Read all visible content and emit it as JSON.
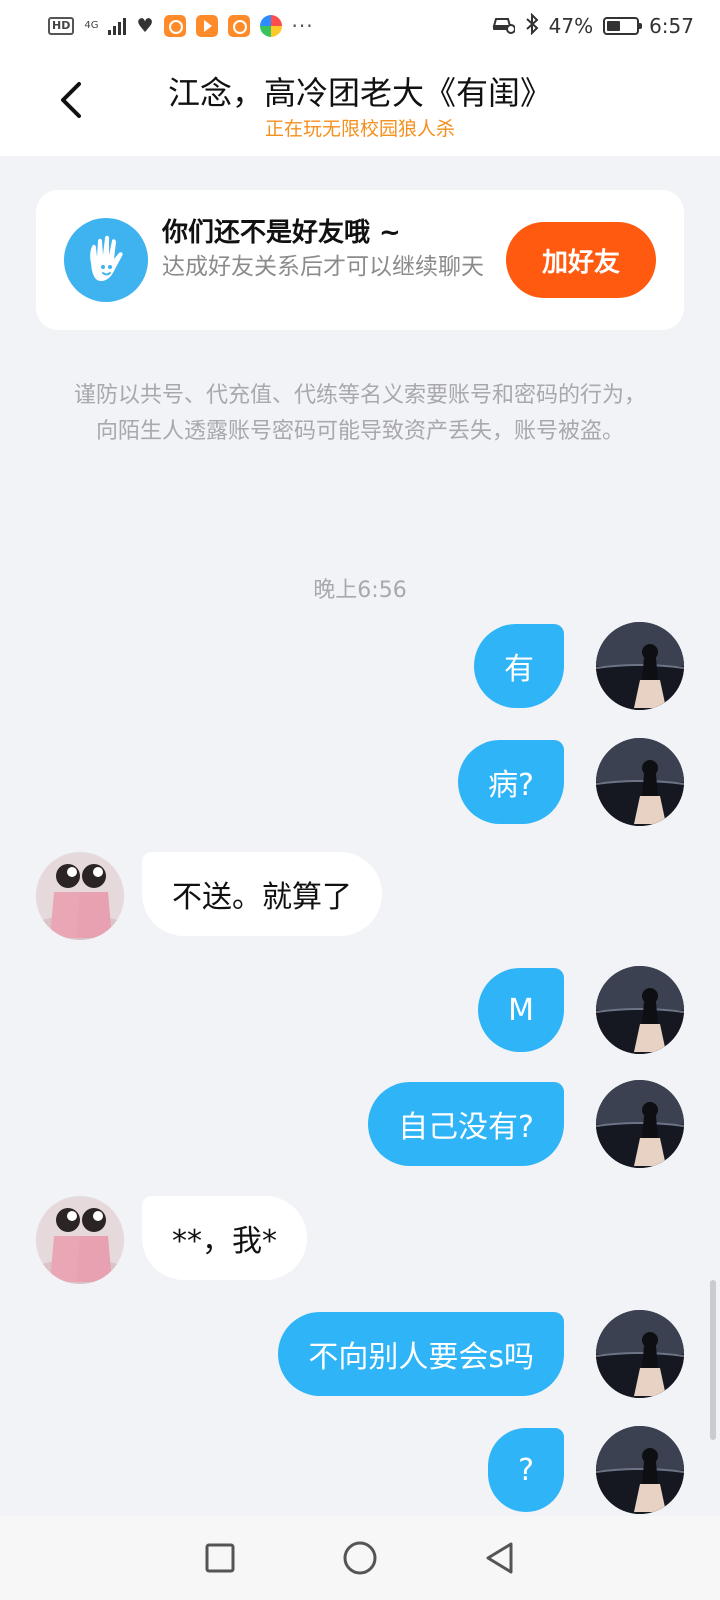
{
  "status_bar": {
    "network_badge": "HD",
    "network_type": "4G",
    "battery_percent": "47%",
    "battery_level": 0.47,
    "time": "6:57",
    "more_dots": "···"
  },
  "header": {
    "title": "江念，高冷团老大《有闺》",
    "subtitle": "正在玩无限校园狼人杀"
  },
  "friend_card": {
    "title": "你们还不是好友哦 ~",
    "description": "达成好友关系后才可以继续聊天",
    "button_label": "加好友"
  },
  "warning_text": "谨防以共号、代充值、代练等名义索要账号和密码的行为，向陌生人透露账号密码可能导致资产丢失，账号被盗。",
  "timestamp": "晚上6:56",
  "messages": [
    {
      "sender": "self",
      "text": "有"
    },
    {
      "sender": "self",
      "text": "病?"
    },
    {
      "sender": "other",
      "text": "不送。就算了"
    },
    {
      "sender": "self",
      "text": "M"
    },
    {
      "sender": "self",
      "text": "自己没有?"
    },
    {
      "sender": "other",
      "text": "**，我*"
    },
    {
      "sender": "self",
      "text": "不向别人要会s吗"
    },
    {
      "sender": "self",
      "text": "?"
    }
  ],
  "colors": {
    "accent_orange": "#ff5a0f",
    "subtitle_orange": "#f4901e",
    "self_bubble": "#2fb4f7",
    "background": "#f1f3f7"
  },
  "icons": {
    "back": "chevron-left-icon",
    "friend": "waving-hand-icon",
    "nav_recent": "square-icon",
    "nav_home": "circle-icon",
    "nav_back": "triangle-back-icon"
  }
}
